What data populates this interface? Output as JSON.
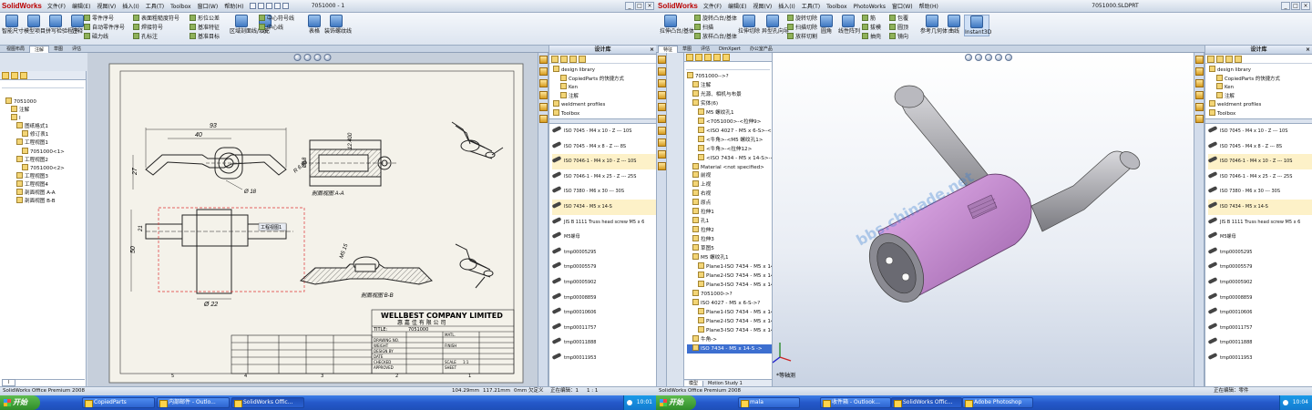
{
  "left": {
    "app_logo": "SolidWorks",
    "menu": [
      "文件(F)",
      "编辑(E)",
      "视图(V)",
      "插入(I)",
      "工具(T)",
      "Toolbox",
      "窗口(W)",
      "帮助(H)"
    ],
    "doc_title": "7051000 - 1",
    "ribbon": {
      "big": [
        "智能尺寸",
        "模型项目",
        "拼写检验程序",
        "注释",
        "零件序号",
        "表格",
        "装饰螺纹线",
        "区域剖面线/填充",
        "块"
      ],
      "small": [
        "零件序号",
        "自动零件序号",
        "磁力线",
        "表面粗糙度符号",
        "焊接符号",
        "孔标注",
        "形位公差",
        "基准特征",
        "基准目标",
        "中心符号线",
        "中心线"
      ]
    },
    "cmtabs": [
      "视图布局",
      "注解",
      "草图",
      "评估"
    ],
    "tree": {
      "root": "7051000",
      "items": [
        "注解",
        "I",
        "图纸格式1",
        "修订表1",
        "工程视图1",
        "7051000<1>",
        "工程视图2",
        "7051000<2>",
        "工程视图3",
        "工程视图4",
        "剖面视图 A-A",
        "剖面视图 B-B"
      ],
      "sheet_tab": "I"
    },
    "drawing": {
      "dims": [
        "93",
        "40",
        "27",
        "Ø18",
        "12.400",
        "R 6.80",
        "Ø 18",
        "12",
        "50",
        "21",
        "Ø 22",
        "M5 15"
      ],
      "view_labels": [
        "剖面视图 A-A",
        "剖面视图 B-B",
        "工程视图1"
      ],
      "section_marks": [
        "A",
        "A",
        "B",
        "B"
      ],
      "title_block": {
        "company": "WELLBEST COMPANY LIMITED",
        "company_cn": "惠 嘉 佳 有 限 公 司",
        "title_label": "TITLE:",
        "title_value": "7051000",
        "rows": [
          "DRAWING NO.",
          "WEIGHT",
          "DESIGN BY",
          "DATE",
          "CHECKED",
          "APPROVED",
          "DATE"
        ],
        "right_rows": [
          "MATL.",
          "FINISH",
          "SCALE",
          "SHEET",
          "1:1"
        ]
      },
      "border_numbers": [
        "5",
        "4",
        "3",
        "2",
        "1"
      ]
    },
    "statusbar": {
      "app": "SolidWorks Office Premium 2008",
      "x": "104.29mm",
      "y": "117.21mm",
      "z": "0mm",
      "state": "欠定义",
      "editing": "正在编辑：1",
      "scale": "1 : 1"
    }
  },
  "taskpane": {
    "title": "设计库",
    "tree": [
      "design library",
      "CopiedParts 的快捷方式",
      "Ken",
      "注解",
      "weldment profiles",
      "Toolbox"
    ],
    "parts": [
      "ISO 7045 - M4 x 10 - Z --- 10S",
      "ISO 7045 - M4 x 8 - Z --- 8S",
      "ISO 7046-1 - M4 x 10 - Z --- 10S",
      "ISO 7046-1 - M4 x 25 - Z --- 25S",
      "ISO 7380 - M6 x 30 --- 30S",
      "ISO 7434 - M5 x 14-S",
      "JIS B 1111 Truss head screw M5 x 6",
      "M5螺母",
      "tmp00005295",
      "tmp00005579",
      "tmp00005902",
      "tmp00008859",
      "tmp00010606",
      "tmp00011757",
      "tmp00011888",
      "tmp00011953"
    ]
  },
  "right": {
    "app_logo": "SolidWorks",
    "menu": [
      "文件(F)",
      "编辑(E)",
      "视图(V)",
      "插入(I)",
      "工具(T)",
      "Toolbox",
      "PhotoWorks",
      "窗口(W)",
      "帮助(H)"
    ],
    "doc_title": "7051000.SLDPRT",
    "ribbon": {
      "items": [
        "拉伸凸台/基体",
        "旋转凸台/基体",
        "扫描",
        "放样凸台/基体",
        "拉伸切除",
        "异型孔向导",
        "旋转切除",
        "扫描切除",
        "放样切割",
        "圆角",
        "线性阵列",
        "筋",
        "拔模",
        "抽壳",
        "包覆",
        "圆顶",
        "镜向",
        "参考几何体",
        "曲线",
        "Instant3D"
      ]
    },
    "cmtabs": [
      "特征",
      "草图",
      "评估",
      "DimXpert",
      "办公室产品"
    ],
    "tree": [
      "7051000-->?",
      "注解",
      "光源、相机与布景",
      "实体(6)",
      "M5 螺纹孔1",
      "<7051000>-<拉伸9>",
      "<ISO 4027 - M5 x 6-S>-<5",
      "<牛角>-<M5 螺纹孔1>",
      "<牛角>-<拉伸12>",
      "<ISO 7434 - M5 x 14-S>-<",
      "Material <not specified>",
      "前视",
      "上视",
      "右视",
      "原点",
      "拉伸1",
      "孔1",
      "拉伸2",
      "拉伸3",
      "草图5",
      "M5 螺纹孔1",
      "Plane1-ISO 7434 - M5 x 14-S",
      "Plane2-ISO 7434 - M5 x 14-S",
      "Plane3-ISO 7434 - M5 x 14-S",
      "7051000->?",
      "ISO 4027 - M5 x 6-S->?",
      "Plane1-ISO 7434 - M5 x 14-S",
      "Plane2-ISO 7434 - M5 x 14-S",
      "Plane3-ISO 7434 - M5 x 14-S",
      "牛角->",
      "ISO 7434 - M5 x 14-S ->"
    ],
    "view_label": "*等轴测",
    "bottom_tabs": [
      "模型",
      "Motion Study 1"
    ],
    "watermark": "bbs.chinade.net",
    "statusbar": {
      "app": "SolidWorks Office Premium 2008",
      "editing": "正在编辑：零件"
    }
  },
  "taskbar_left": {
    "start": "开始",
    "buttons": [
      "CopiedParts",
      "内部邮件 - Outlo...",
      "SolidWorks Offic..."
    ],
    "time": "10:01"
  },
  "taskbar_right": {
    "start": "开始",
    "buttons": [
      "mala",
      "收件箱 - Outlook...",
      "SolidWorks Offic...",
      "Adobe Photoshop"
    ],
    "time": "10:04"
  },
  "colors": {
    "accent": "#3d6fd0",
    "solid_gray": "#a9a9ad",
    "solid_pink": "#c98bd6",
    "viewport_top": "#ffffff",
    "viewport_bottom": "#c9d3e3"
  }
}
